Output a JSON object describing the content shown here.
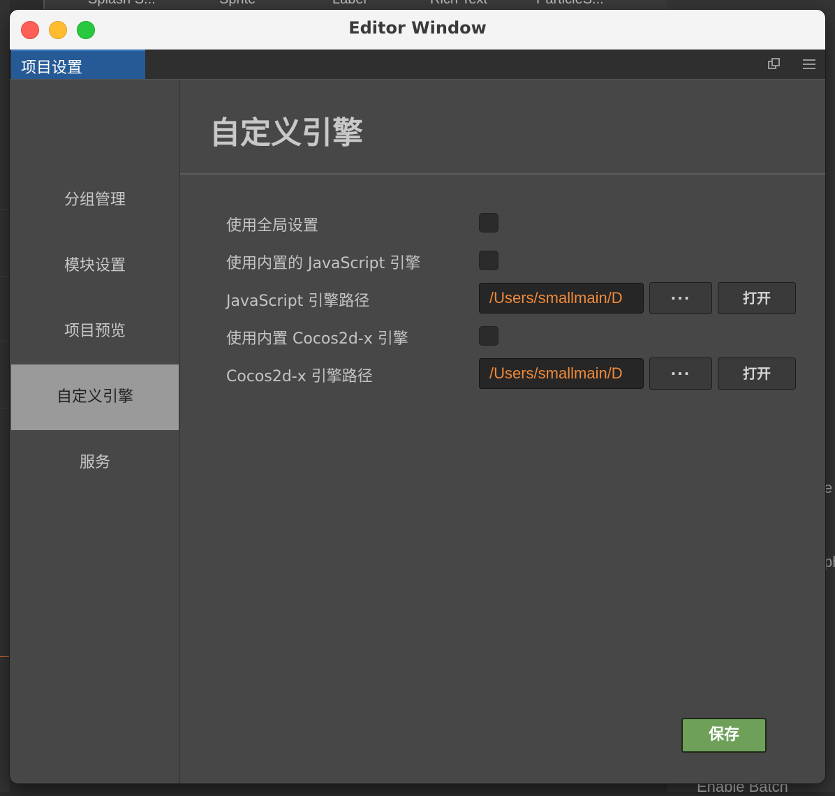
{
  "background": {
    "toolbar_tabs": [
      "Splash S...",
      "Sprite",
      "Label",
      "Rich Text",
      "ParticleS..."
    ],
    "right_fragments": [
      "e",
      "ph"
    ],
    "bottom_text": "Enable Batch"
  },
  "window": {
    "title": "Editor Window",
    "tab_label": "项目设置"
  },
  "sidebar": {
    "items": [
      {
        "label": "分组管理",
        "active": false
      },
      {
        "label": "模块设置",
        "active": false
      },
      {
        "label": "项目预览",
        "active": false
      },
      {
        "label": "自定义引擎",
        "active": true
      },
      {
        "label": "服务",
        "active": false
      }
    ]
  },
  "main": {
    "title": "自定义引擎",
    "rows": [
      {
        "label": "使用全局设置",
        "type": "checkbox",
        "checked": false
      },
      {
        "label": "使用内置的 JavaScript 引擎",
        "type": "checkbox",
        "checked": false
      },
      {
        "label": "JavaScript 引擎路径",
        "type": "path",
        "value": "/Users/smallmain/D",
        "browse_label": "···",
        "open_label": "打开"
      },
      {
        "label": "使用内置 Cocos2d-x 引擎",
        "type": "checkbox",
        "checked": false
      },
      {
        "label": "Cocos2d-x 引擎路径",
        "type": "path",
        "value": "/Users/smallmain/D",
        "browse_label": "···",
        "open_label": "打开"
      }
    ],
    "save_label": "保存"
  },
  "colors": {
    "accent_tab": "#265a97",
    "path_text": "#f08a3a",
    "save_button": "#6ea05a",
    "sidebar_active": "#9a9a9a"
  },
  "icons": {
    "tab_popout": "popout-icon",
    "tab_menu": "hamburger-menu-icon"
  }
}
